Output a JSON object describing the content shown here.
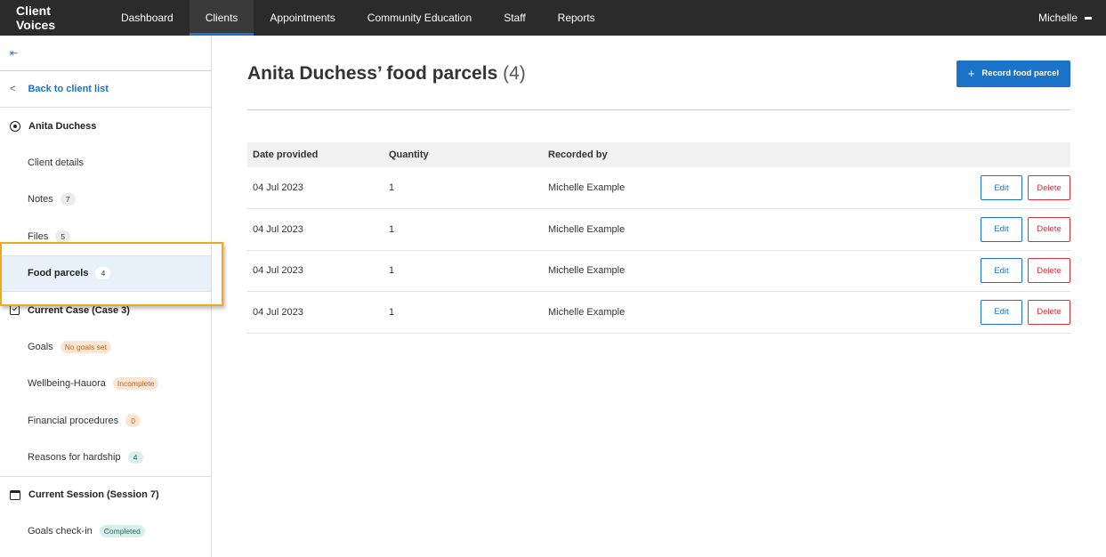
{
  "nav": {
    "brand": "Client Voices",
    "items": [
      "Dashboard",
      "Clients",
      "Appointments",
      "Community Education",
      "Staff",
      "Reports"
    ],
    "active": "Clients",
    "user": "Michelle"
  },
  "sidebar": {
    "collapse_icon": "⇤",
    "back_label": "Back to client list",
    "client_name": "Anita Duchess",
    "items": [
      {
        "label": "Client details"
      },
      {
        "label": "Notes",
        "badge": "7"
      },
      {
        "label": "Files",
        "badge": "5"
      },
      {
        "label": "Food parcels",
        "badge": "4"
      }
    ],
    "case_title": "Current Case (Case 3)",
    "case_items": [
      {
        "label": "Goals",
        "badge": "No goals set"
      },
      {
        "label": "Wellbeing-Hauora",
        "badge": "Incomplete"
      },
      {
        "label": "Financial procedures",
        "badge": "0"
      },
      {
        "label": "Reasons for hardship",
        "badge": "4"
      }
    ],
    "session_title": "Current Session (Session 7)",
    "session_items": [
      {
        "label": "Goals check-in",
        "badge": "Completed"
      }
    ]
  },
  "main": {
    "title": "Anita Duchess’ food parcels",
    "title_count": "(4)",
    "record_button": "Record food parcel",
    "columns": [
      "Date provided",
      "Quantity",
      "Recorded by"
    ],
    "rows": [
      {
        "date": "04 Jul 2023",
        "quantity": "1",
        "recorded_by": "Michelle Example"
      },
      {
        "date": "04 Jul 2023",
        "quantity": "1",
        "recorded_by": "Michelle Example"
      },
      {
        "date": "04 Jul 2023",
        "quantity": "1",
        "recorded_by": "Michelle Example"
      },
      {
        "date": "04 Jul 2023",
        "quantity": "1",
        "recorded_by": "Michelle Example"
      }
    ],
    "edit_label": "Edit",
    "delete_label": "Delete"
  },
  "colors": {
    "accent": "#1a73c9",
    "danger": "#d6343d",
    "highlight": "#f0a81c"
  }
}
